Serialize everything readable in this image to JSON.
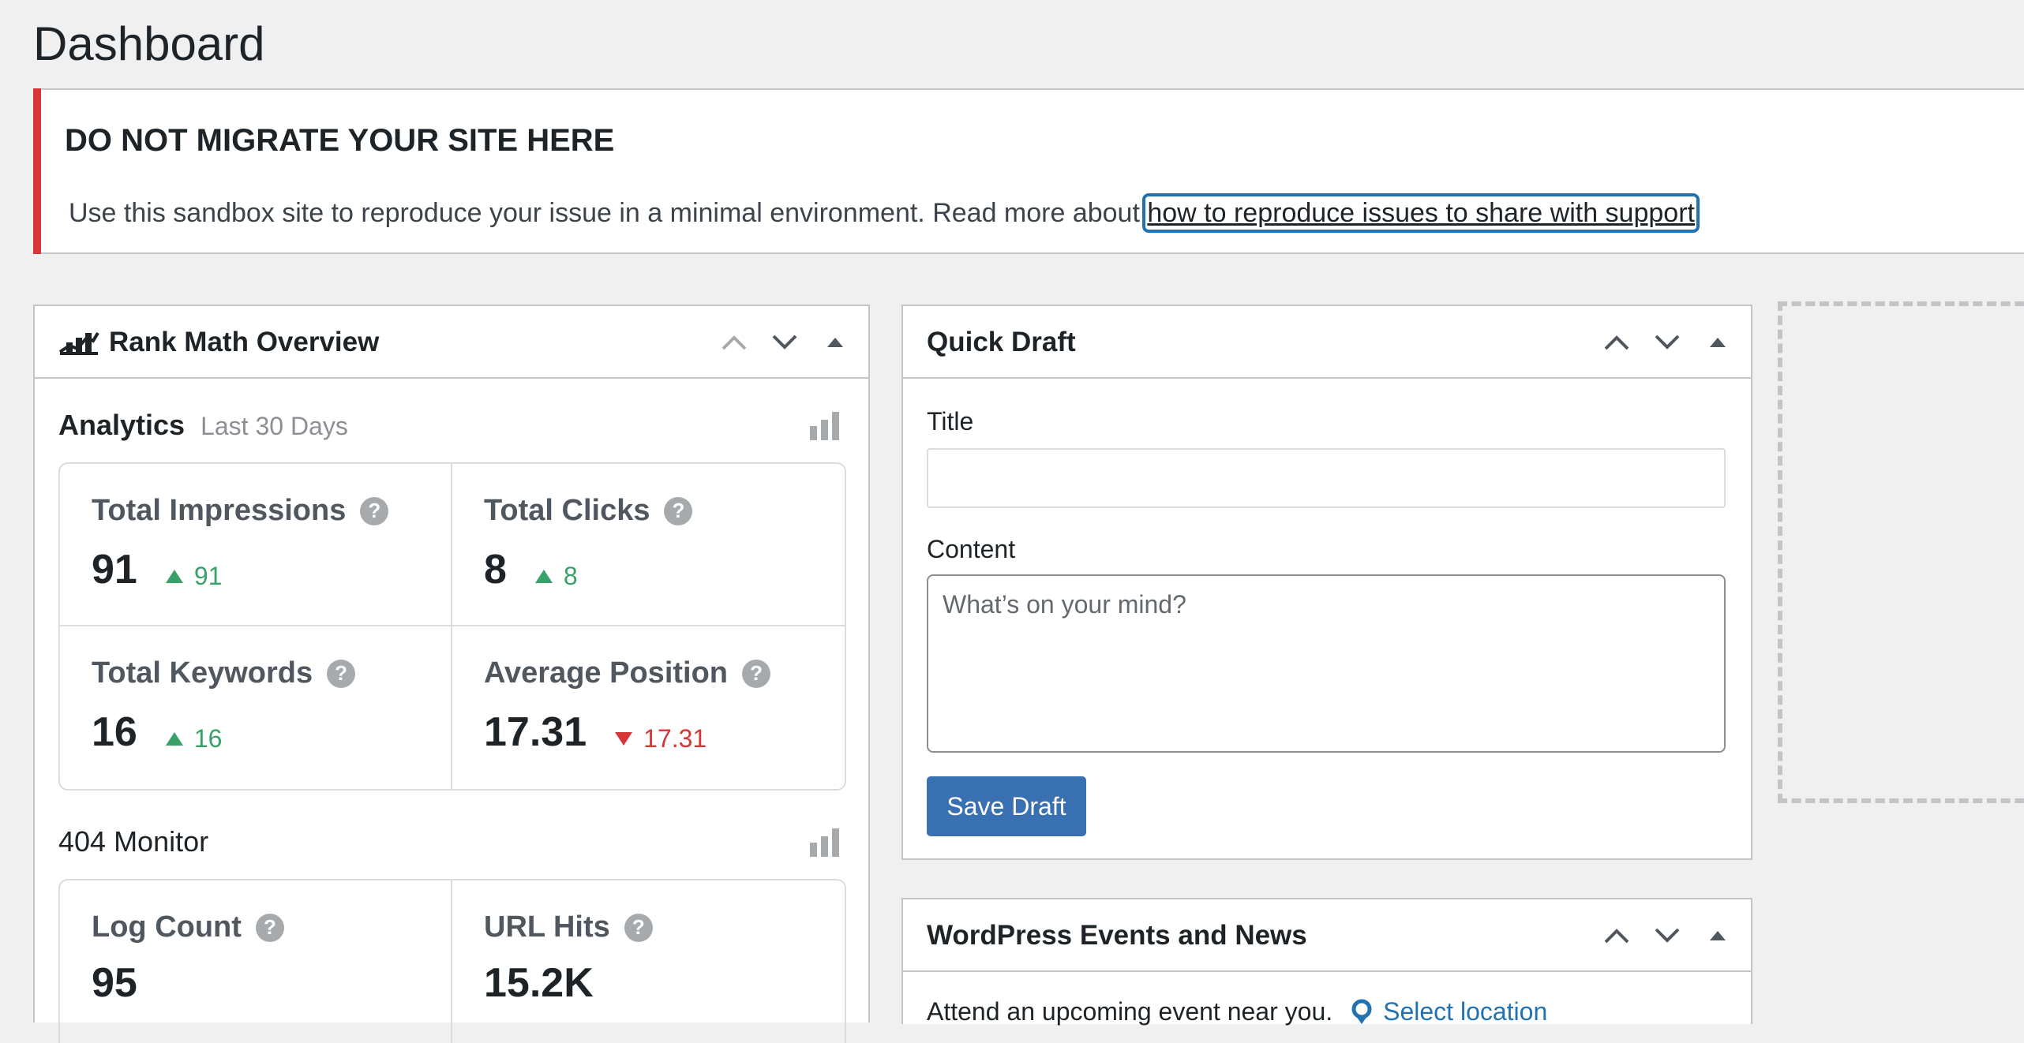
{
  "page": {
    "title": "Dashboard"
  },
  "notice": {
    "title": "DO NOT MIGRATE YOUR SITE HERE",
    "text": "Use this sandbox site to reproduce your issue in a minimal environment. Read more about ",
    "link_text": "how to reproduce issues to share with support",
    "accent_color": "#d63638"
  },
  "rank_math": {
    "title": "Rank Math Overview",
    "analytics": {
      "label": "Analytics",
      "period": "Last 30 Days",
      "stats": [
        {
          "label": "Total Impressions",
          "value": "91",
          "change": "91",
          "direction": "up"
        },
        {
          "label": "Total Clicks",
          "value": "8",
          "change": "8",
          "direction": "up"
        },
        {
          "label": "Total Keywords",
          "value": "16",
          "change": "16",
          "direction": "up"
        },
        {
          "label": "Average Position",
          "value": "17.31",
          "change": "17.31",
          "direction": "down"
        }
      ]
    },
    "monitor": {
      "label": "404 Monitor",
      "stats": [
        {
          "label": "Log Count",
          "value": "95"
        },
        {
          "label": "URL Hits",
          "value": "15.2K"
        }
      ]
    }
  },
  "quick_draft": {
    "title": "Quick Draft",
    "title_label": "Title",
    "title_value": "",
    "content_label": "Content",
    "content_placeholder": "What’s on your mind?",
    "save_label": "Save Draft"
  },
  "events": {
    "title": "WordPress Events and News",
    "text": "Attend an upcoming event near you.",
    "select_location": "Select location"
  },
  "colors": {
    "primary_button": "#3870b2",
    "up": "#38a169",
    "down": "#d63638",
    "link": "#2271b1"
  },
  "icons": {
    "handle_up": "chevron-up-icon",
    "handle_down": "chevron-down-icon",
    "toggle": "triangle-up-icon",
    "chart": "bar-chart-icon",
    "help": "help-circle-icon",
    "location": "location-pin-icon",
    "rank_math": "rank-math-logo-icon"
  }
}
